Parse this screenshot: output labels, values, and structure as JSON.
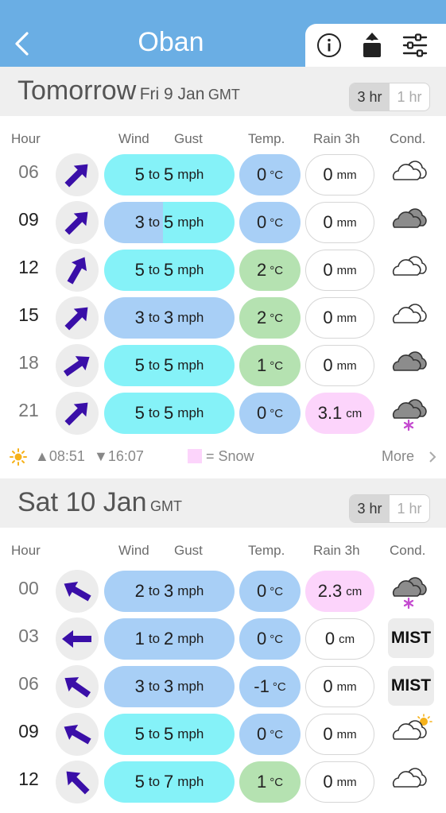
{
  "header": {
    "back_icon": "chevron-left-icon",
    "title": "Oban",
    "info_icon": "info-icon",
    "share_icon": "share-icon",
    "settings_icon": "sliders-icon"
  },
  "colors": {
    "header_bg": "#6aaee4",
    "wind_cyan": "#85f2f8",
    "wind_blue": "#a8cff6",
    "temp_green": "#b5e2b1",
    "snow_pink": "#fcd4fb",
    "arrow": "#3a0fa8"
  },
  "columns": {
    "hour": "Hour",
    "wind": "Wind",
    "gust": "Gust",
    "temp": "Temp.",
    "rain": "Rain 3h",
    "cond": "Cond."
  },
  "toggle": {
    "three_hr": "3 hr",
    "one_hr": "1 hr",
    "selected": "3 hr"
  },
  "days": [
    {
      "day_word": "Tomorrow",
      "date": "Fri 9 Jan",
      "tz": "GMT",
      "rows": [
        {
          "hour": "06",
          "wind": "5",
          "to": "to",
          "gust": "5",
          "wind_unit": "mph",
          "temp": "0",
          "temp_unit": "°C",
          "rain": "0",
          "rain_unit": "mm",
          "cond": "cloud-light-icon"
        },
        {
          "hour": "09",
          "wind": "3",
          "to": "to",
          "gust": "5",
          "wind_unit": "mph",
          "temp": "0",
          "temp_unit": "°C",
          "rain": "0",
          "rain_unit": "mm",
          "cond": "cloud-dark-icon"
        },
        {
          "hour": "12",
          "wind": "5",
          "to": "to",
          "gust": "5",
          "wind_unit": "mph",
          "temp": "2",
          "temp_unit": "°C",
          "rain": "0",
          "rain_unit": "mm",
          "cond": "cloud-light-icon"
        },
        {
          "hour": "15",
          "wind": "3",
          "to": "to",
          "gust": "3",
          "wind_unit": "mph",
          "temp": "2",
          "temp_unit": "°C",
          "rain": "0",
          "rain_unit": "mm",
          "cond": "cloud-light-icon"
        },
        {
          "hour": "18",
          "wind": "5",
          "to": "to",
          "gust": "5",
          "wind_unit": "mph",
          "temp": "1",
          "temp_unit": "°C",
          "rain": "0",
          "rain_unit": "mm",
          "cond": "cloud-dark-icon"
        },
        {
          "hour": "21",
          "wind": "5",
          "to": "to",
          "gust": "5",
          "wind_unit": "mph",
          "temp": "0",
          "temp_unit": "°C",
          "rain": "3.1",
          "rain_unit": "cm",
          "cond": "cloud-snow-icon"
        }
      ],
      "footer": {
        "sun_icon": "sun-icon",
        "sunrise": "▲08:51",
        "sunset": "▼16:07",
        "legend": "= Snow",
        "more": "More"
      }
    },
    {
      "day_word": "",
      "date": "Sat 10 Jan",
      "tz": "GMT",
      "rows": [
        {
          "hour": "00",
          "wind": "2",
          "to": "to",
          "gust": "3",
          "wind_unit": "mph",
          "temp": "0",
          "temp_unit": "°C",
          "rain": "2.3",
          "rain_unit": "cm",
          "cond": "cloud-snow-icon"
        },
        {
          "hour": "03",
          "wind": "1",
          "to": "to",
          "gust": "2",
          "wind_unit": "mph",
          "temp": "0",
          "temp_unit": "°C",
          "rain": "0",
          "rain_unit": "cm",
          "cond": "MIST"
        },
        {
          "hour": "06",
          "wind": "3",
          "to": "to",
          "gust": "3",
          "wind_unit": "mph",
          "temp": "-1",
          "temp_unit": "°C",
          "rain": "0",
          "rain_unit": "mm",
          "cond": "MIST"
        },
        {
          "hour": "09",
          "wind": "5",
          "to": "to",
          "gust": "5",
          "wind_unit": "mph",
          "temp": "0",
          "temp_unit": "°C",
          "rain": "0",
          "rain_unit": "mm",
          "cond": "cloud-sun-icon"
        },
        {
          "hour": "12",
          "wind": "5",
          "to": "to",
          "gust": "7",
          "wind_unit": "mph",
          "temp": "1",
          "temp_unit": "°C",
          "rain": "0",
          "rain_unit": "mm",
          "cond": "cloud-light-icon"
        }
      ]
    }
  ]
}
